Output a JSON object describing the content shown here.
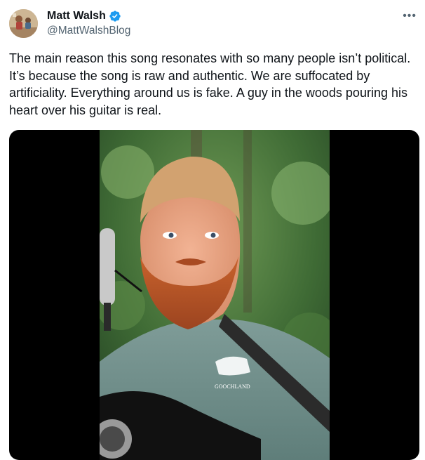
{
  "author": {
    "display_name": "Matt Walsh",
    "handle": "@MattWalshBlog",
    "verified": true
  },
  "post": {
    "text": "The main reason this song resonates with so many people isn’t political. It’s because the song is raw and authentic. We are suffocated by artificiality. Everything around us is fake. A guy in the woods pouring his heart over his guitar is real."
  },
  "media": {
    "shirt_text": "GOOCHLAND",
    "type": "video"
  },
  "icons": {
    "verified": "verified-badge-icon",
    "more": "more-options-icon"
  },
  "colors": {
    "text_primary": "#0f1419",
    "text_secondary": "#536471",
    "verified_blue": "#1d9bf0",
    "media_background": "#000000"
  }
}
